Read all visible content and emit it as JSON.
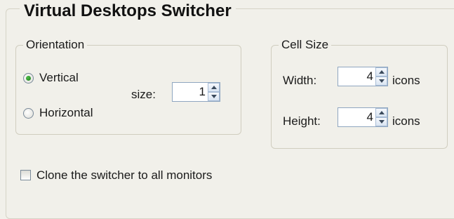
{
  "panel": {
    "title": "Virtual Desktops Switcher"
  },
  "orientation": {
    "group_title": "Orientation",
    "options": [
      {
        "label": "Vertical",
        "checked": true
      },
      {
        "label": "Horizontal",
        "checked": false
      }
    ],
    "size_label": "size:",
    "size_value": "1"
  },
  "cell_size": {
    "group_title": "Cell Size",
    "width_label": "Width:",
    "width_value": "4",
    "height_label": "Height:",
    "height_value": "4",
    "unit_label": "icons"
  },
  "clone": {
    "label": "Clone the switcher to all monitors",
    "checked": false
  },
  "icons": {
    "spin_up": "triangle-up-icon",
    "spin_down": "triangle-down-icon"
  }
}
